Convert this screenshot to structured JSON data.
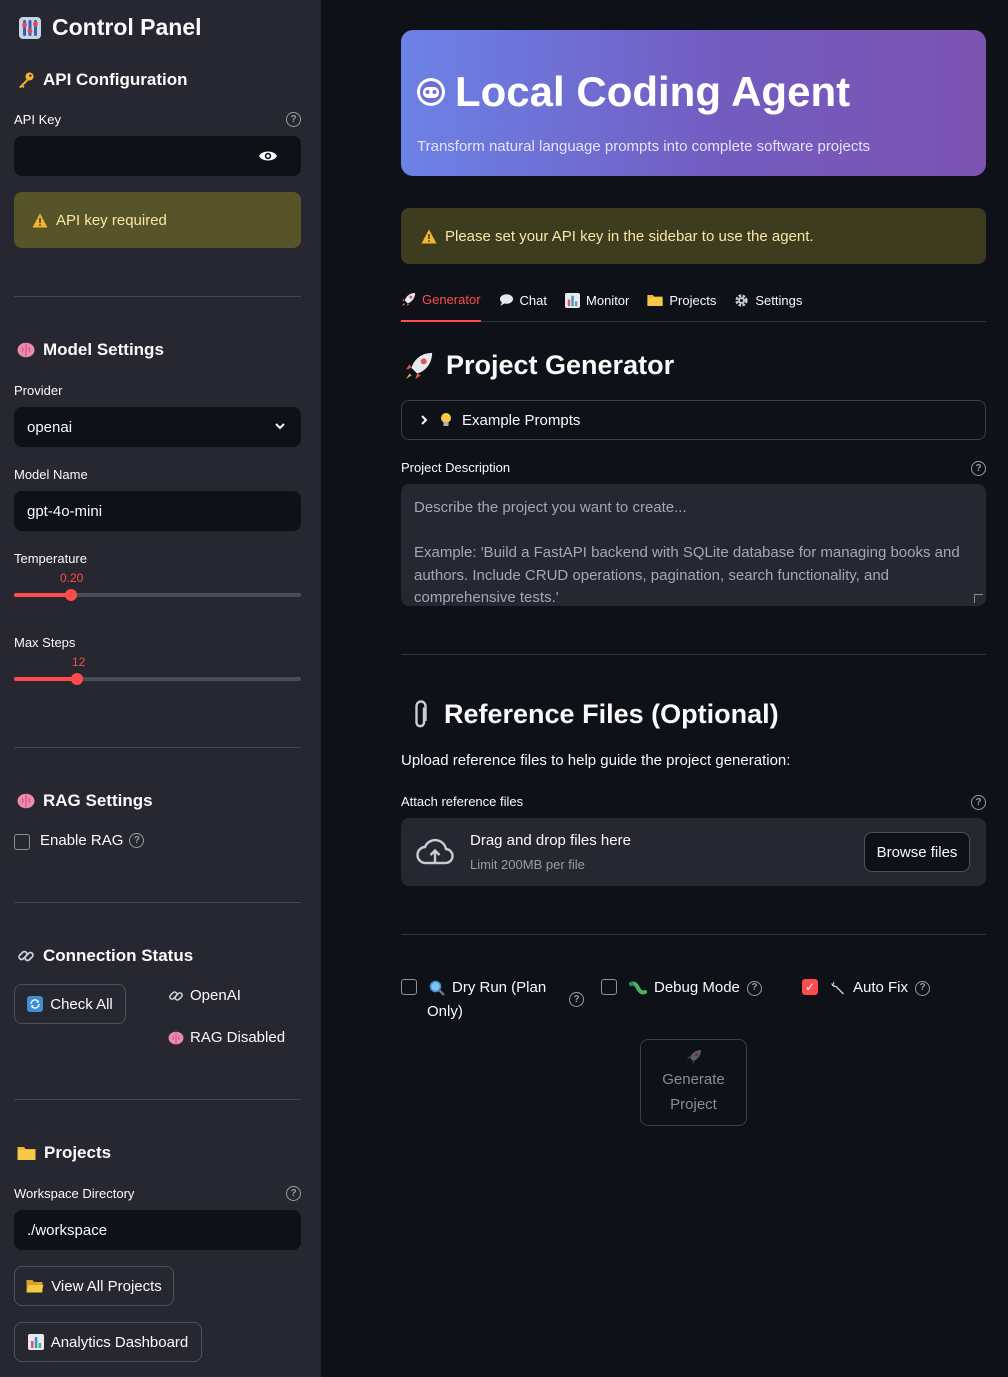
{
  "sidebar": {
    "title": "Control Panel",
    "api": {
      "heading": "API Configuration",
      "key_label": "API Key",
      "key_value": "",
      "warning": "API key required"
    },
    "model": {
      "heading": "Model Settings",
      "provider_label": "Provider",
      "provider_value": "openai",
      "model_label": "Model Name",
      "model_value": "gpt-4o-mini",
      "temperature_label": "Temperature",
      "temperature_value": "0.20",
      "temperature_fraction": 0.2,
      "max_steps_label": "Max Steps",
      "max_steps_value": "12",
      "max_steps_fraction": 0.22
    },
    "rag": {
      "heading": "RAG Settings",
      "enable_label": "Enable RAG",
      "enabled": false
    },
    "connection": {
      "heading": "Connection Status",
      "check_all_label": "Check All",
      "openai_label": "OpenAI",
      "rag_label": "RAG Disabled"
    },
    "projects": {
      "heading": "Projects",
      "workspace_label": "Workspace Directory",
      "workspace_value": "./workspace",
      "view_all_label": "View All Projects",
      "analytics_label": "Analytics Dashboard"
    }
  },
  "hero": {
    "title": "Local Coding Agent",
    "subtitle": "Transform natural language prompts into complete software projects"
  },
  "main_warning": "Please set your API key in the sidebar to use the agent.",
  "tabs": [
    {
      "label": "Generator",
      "icon": "rocket-icon",
      "active": true
    },
    {
      "label": "Chat",
      "icon": "speech-bubble-icon",
      "active": false
    },
    {
      "label": "Monitor",
      "icon": "bar-chart-icon",
      "active": false
    },
    {
      "label": "Projects",
      "icon": "folder-icon",
      "active": false
    },
    {
      "label": "Settings",
      "icon": "gear-icon",
      "active": false
    }
  ],
  "generator": {
    "heading": "Project Generator",
    "example_prompts_label": "Example Prompts",
    "description_label": "Project Description",
    "description_placeholder_line1": "Describe the project you want to create...",
    "description_placeholder_line2": "Example: 'Build a FastAPI backend with SQLite database for managing books and authors. Include CRUD operations, pagination, search functionality, and comprehensive tests.'"
  },
  "reference": {
    "heading": "Reference Files (Optional)",
    "intro": "Upload reference files to help guide the project generation:",
    "attach_label": "Attach reference files",
    "drag_text": "Drag and drop files here",
    "limit_text": "Limit 200MB per file",
    "browse_label": "Browse files"
  },
  "options": {
    "dry_run_label_1": "Dry Run (Plan",
    "dry_run_label_2": "Only)",
    "dry_run_checked": false,
    "debug_label": "Debug Mode",
    "debug_checked": false,
    "auto_fix_label": "Auto Fix",
    "auto_fix_checked": true
  },
  "generate_button": {
    "line1": "Generate",
    "line2": "Project"
  },
  "colors": {
    "accent": "#ff4b4b",
    "sidebar_bg": "#262730",
    "main_bg": "#0e1117",
    "warning_bg": "#3d3c1f",
    "warning_text": "#f8e7a6"
  }
}
